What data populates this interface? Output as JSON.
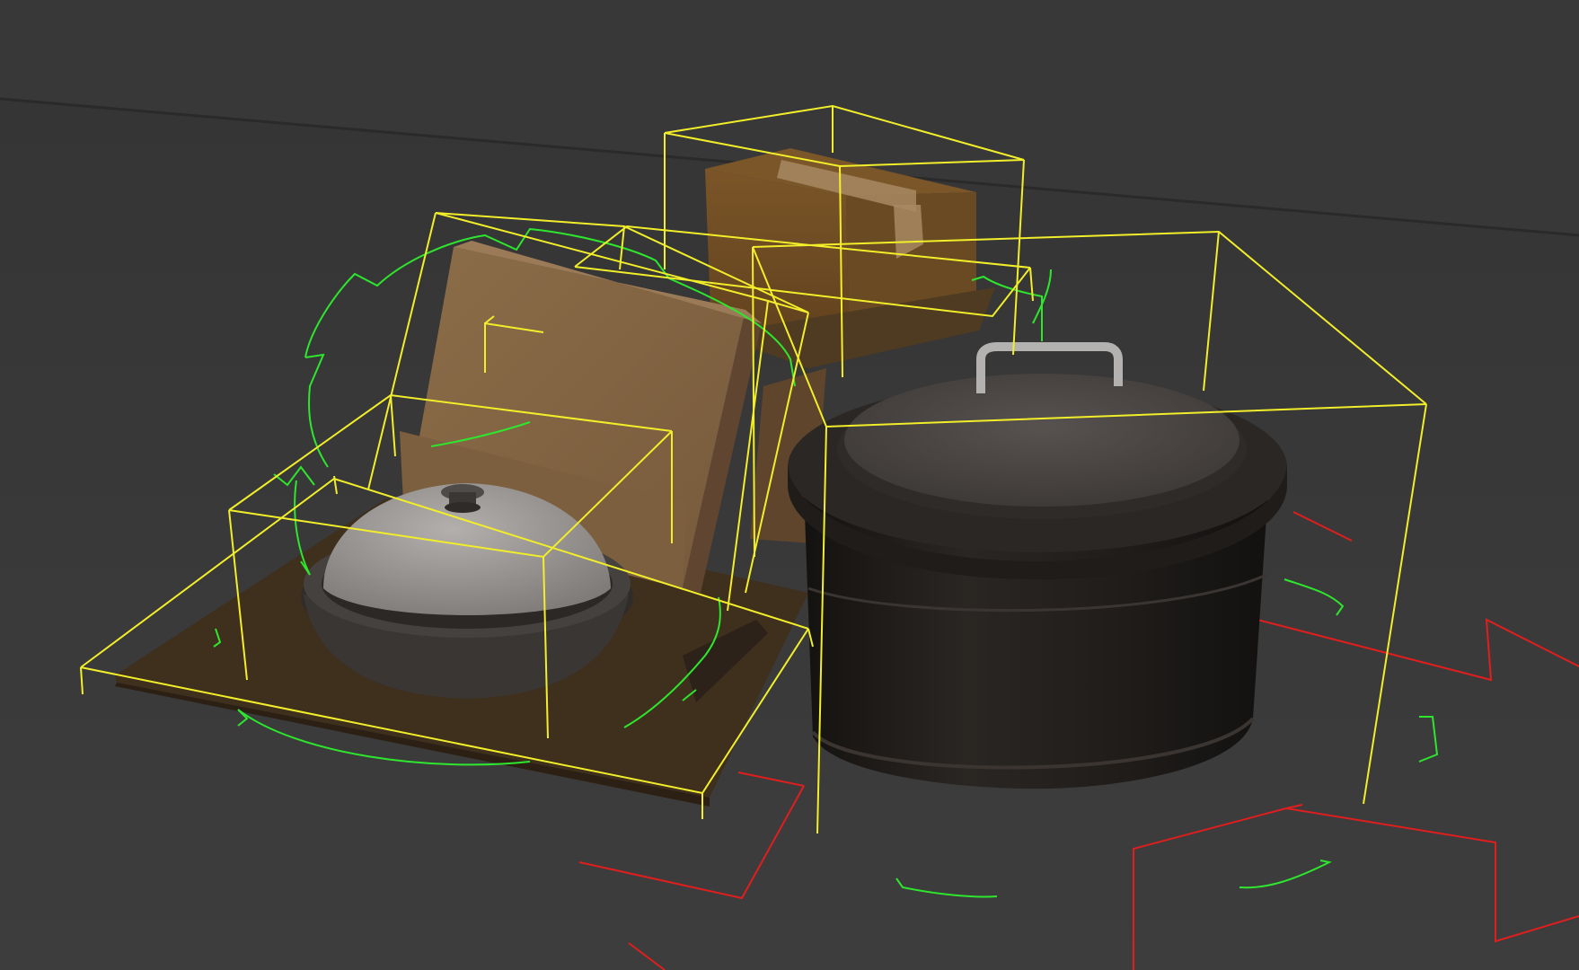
{
  "viewport": {
    "view": "perspective",
    "colors": {
      "background_upper": "#393939",
      "background_floor": "#3d3d3d",
      "bounding_box": "#f2ee2a",
      "selection_ring": "#2ee62e",
      "gizmo_red": "#e01e1e",
      "cardboard": "#8a6a47",
      "tray": "#3f2f1d",
      "pot_body": "#1e1b19",
      "lid_grey": "#9a9694"
    },
    "objects": [
      {
        "name": "cardboard-box",
        "icon": "box-icon"
      },
      {
        "name": "folder-cardboard-sheet",
        "icon": "folder-icon"
      },
      {
        "name": "cutting-board-tray",
        "icon": "tray-icon"
      },
      {
        "name": "small-pot-with-lid",
        "icon": "pot-icon"
      },
      {
        "name": "large-cooking-pot",
        "icon": "pot-icon"
      }
    ]
  }
}
